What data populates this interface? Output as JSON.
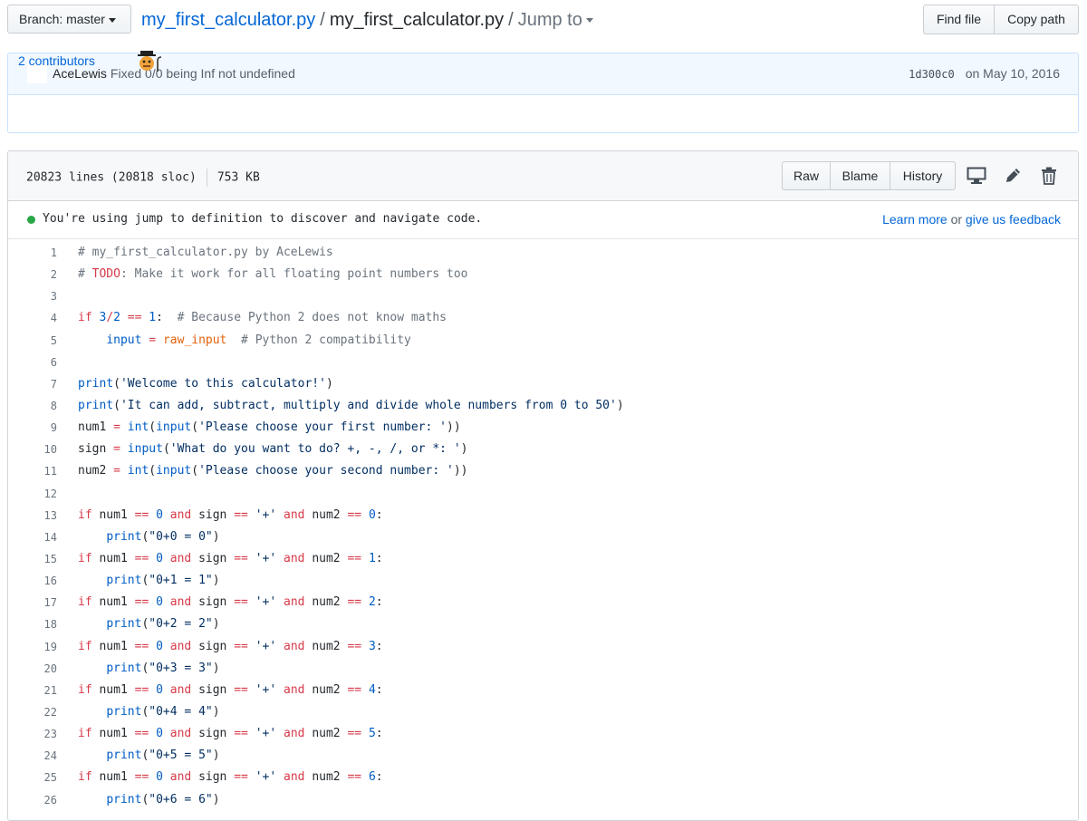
{
  "topbar": {
    "branch_label": "Branch: master",
    "repo": "my_first_calculator.py",
    "sep": "/",
    "file": "my_first_calculator.py",
    "sep2": "/",
    "jump_to": "Jump to",
    "find_file": "Find file",
    "copy_path": "Copy path"
  },
  "commit": {
    "author": "AceLewis",
    "message": "Fixed 0/0 being Inf not undefined",
    "sha": "1d300c0",
    "date": "on May 10, 2016",
    "contributors": "2 contributors"
  },
  "file": {
    "lines_info": "20823 lines (20818 sloc)",
    "size": "753 KB",
    "raw": "Raw",
    "blame": "Blame",
    "history": "History",
    "icons": [
      "desktop-icon",
      "pencil-icon",
      "trash-icon"
    ]
  },
  "jump_bar": {
    "message": "You're using jump to definition to discover and navigate code.",
    "learn_more": "Learn more",
    "or": "or",
    "feedback": "give us feedback"
  },
  "code_lines": [
    {
      "n": "1",
      "code": "# my_first_calculator.py by AceLewis"
    },
    {
      "n": "2",
      "code": "# TODO: Make it work for all floating point numbers too"
    },
    {
      "n": "3",
      "code": ""
    },
    {
      "n": "4",
      "code": "if 3/2 == 1:  # Because Python 2 does not know maths"
    },
    {
      "n": "5",
      "code": "    input = raw_input  # Python 2 compatibility"
    },
    {
      "n": "6",
      "code": ""
    },
    {
      "n": "7",
      "code": "print('Welcome to this calculator!')"
    },
    {
      "n": "8",
      "code": "print('It can add, subtract, multiply and divide whole numbers from 0 to 50')"
    },
    {
      "n": "9",
      "code": "num1 = int(input('Please choose your first number: '))"
    },
    {
      "n": "10",
      "code": "sign = input('What do you want to do? +, -, /, or *: ')"
    },
    {
      "n": "11",
      "code": "num2 = int(input('Please choose your second number: '))"
    },
    {
      "n": "12",
      "code": ""
    },
    {
      "n": "13",
      "code": "if num1 == 0 and sign == '+' and num2 == 0:"
    },
    {
      "n": "14",
      "code": "    print(\"0+0 = 0\")"
    },
    {
      "n": "15",
      "code": "if num1 == 0 and sign == '+' and num2 == 1:"
    },
    {
      "n": "16",
      "code": "    print(\"0+1 = 1\")"
    },
    {
      "n": "17",
      "code": "if num1 == 0 and sign == '+' and num2 == 2:"
    },
    {
      "n": "18",
      "code": "    print(\"0+2 = 2\")"
    },
    {
      "n": "19",
      "code": "if num1 == 0 and sign == '+' and num2 == 3:"
    },
    {
      "n": "20",
      "code": "    print(\"0+3 = 3\")"
    },
    {
      "n": "21",
      "code": "if num1 == 0 and sign == '+' and num2 == 4:"
    },
    {
      "n": "22",
      "code": "    print(\"0+4 = 4\")"
    },
    {
      "n": "23",
      "code": "if num1 == 0 and sign == '+' and num2 == 5:"
    },
    {
      "n": "24",
      "code": "    print(\"0+5 = 5\")"
    },
    {
      "n": "25",
      "code": "if num1 == 0 and sign == '+' and num2 == 6:"
    },
    {
      "n": "26",
      "code": "    print(\"0+6 = 6\")"
    }
  ],
  "colors": {
    "link": "#0366d6",
    "keyword": "#d73a49",
    "number": "#005cc5",
    "string": "#032f62",
    "comment": "#6a737d",
    "green_dot": "#28a745"
  }
}
